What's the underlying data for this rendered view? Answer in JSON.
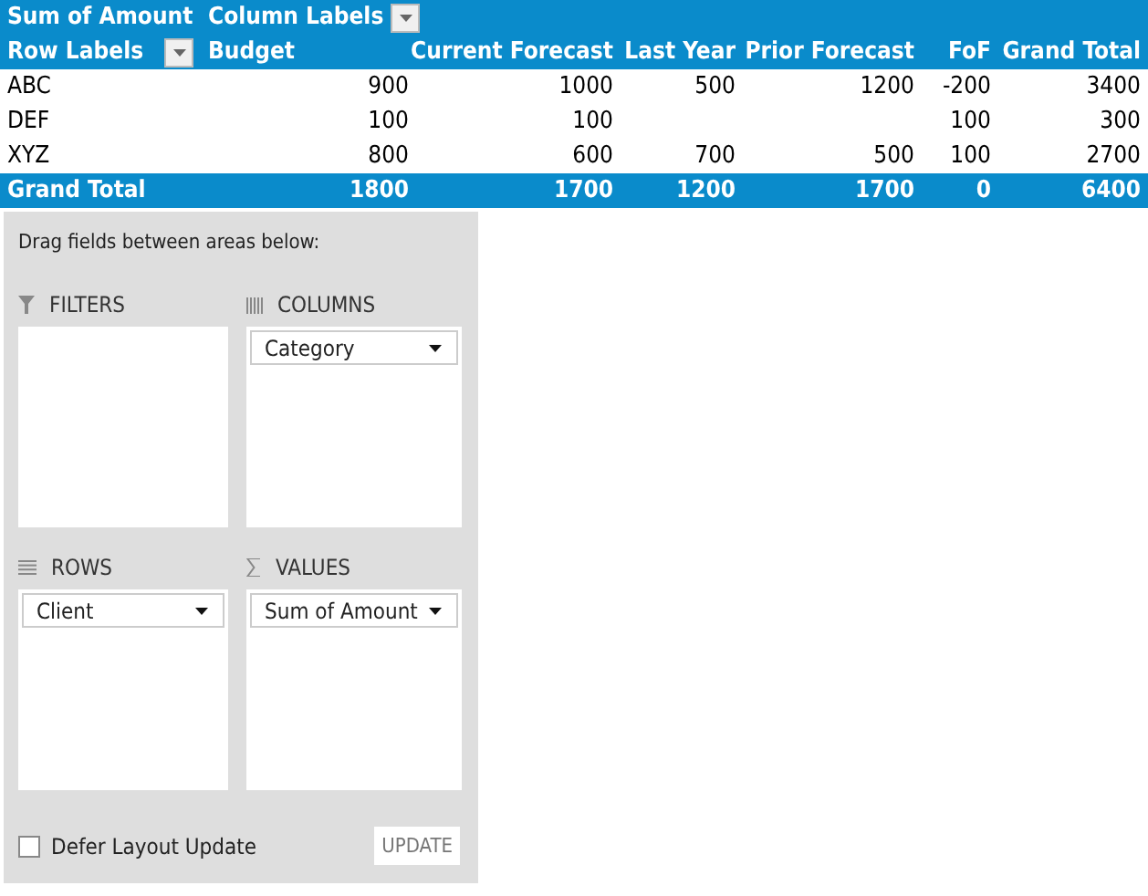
{
  "pivot": {
    "corner": "Sum of Amount",
    "column_labels": "Column Labels",
    "row_labels": "Row Labels",
    "columns": [
      "Budget",
      "Current Forecast",
      "Last Year",
      "Prior Forecast",
      "FoF",
      "Grand Total"
    ],
    "rows": [
      {
        "label": "ABC",
        "cells": [
          "900",
          "1000",
          "500",
          "1200",
          "-200",
          "3400"
        ]
      },
      {
        "label": "DEF",
        "cells": [
          "100",
          "100",
          null,
          null,
          "100",
          "300"
        ]
      },
      {
        "label": "XYZ",
        "cells": [
          "800",
          "600",
          "700",
          "500",
          "100",
          "2700"
        ]
      }
    ],
    "total": {
      "label": "Grand Total",
      "cells": [
        "1800",
        "1700",
        "1200",
        "1700",
        "0",
        "6400"
      ]
    }
  },
  "field_list": {
    "instruction": "Drag fields between areas below:",
    "areas": [
      {
        "kind": "filters",
        "title": "FILTERS"
      },
      {
        "kind": "columns",
        "title": "COLUMNS",
        "fields": [
          "Category"
        ]
      },
      {
        "kind": "rows",
        "title": "ROWS",
        "fields": [
          "Client"
        ]
      },
      {
        "kind": "values",
        "title": "VALUES",
        "fields": [
          "Sum of Amount"
        ]
      }
    ],
    "defer": {
      "label": "Defer Layout Update",
      "checked": false
    },
    "update_button": "UPDATE"
  }
}
